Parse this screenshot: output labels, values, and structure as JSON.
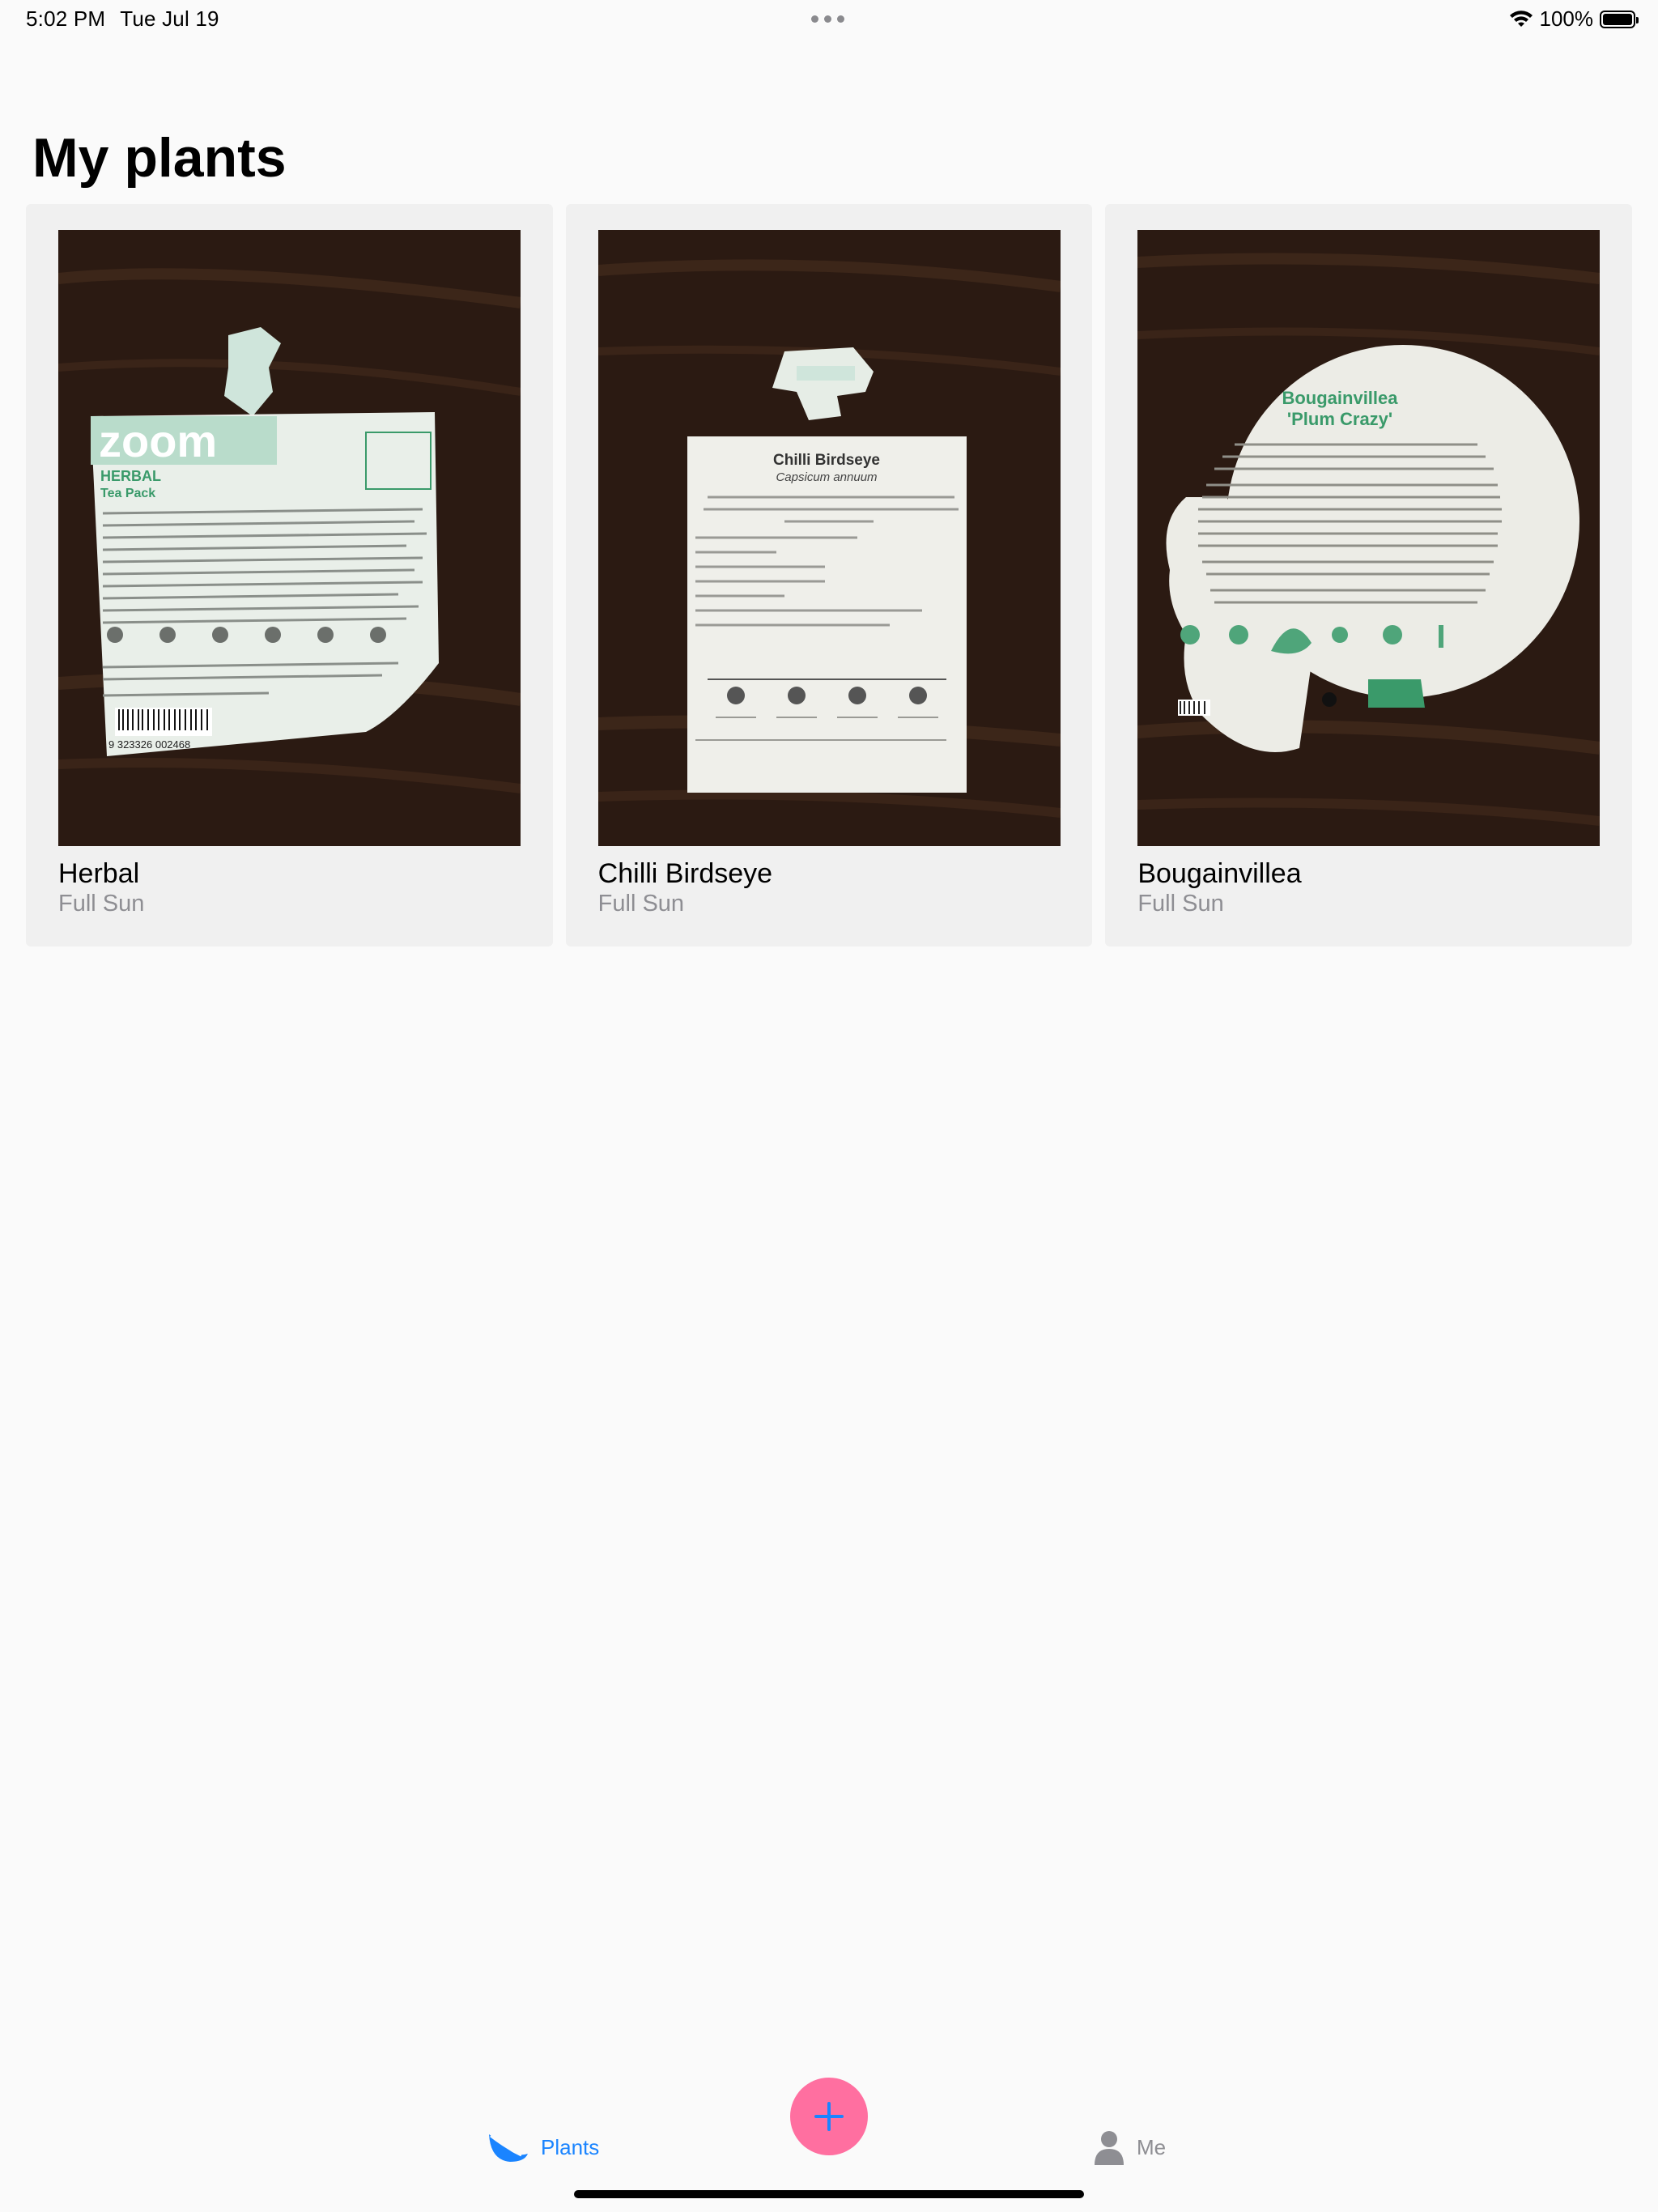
{
  "status_bar": {
    "time": "5:02 PM",
    "date": "Tue Jul 19",
    "battery": "100%"
  },
  "page": {
    "title": "My plants"
  },
  "plants": [
    {
      "name": "Herbal",
      "sun": "Full Sun",
      "photo": {
        "label_brand": "zoom",
        "label_title": "HERBAL",
        "label_subtitle": "Tea Pack",
        "barcode_number": "9 323326 002468"
      }
    },
    {
      "name": "Chilli Birdseye",
      "sun": "Full Sun",
      "photo": {
        "label_title": "Chilli Birdseye",
        "label_subtitle": "Capsicum annuum"
      }
    },
    {
      "name": "Bougainvillea",
      "sun": "Full Sun",
      "photo": {
        "label_title": "Bougainvillea",
        "label_subtitle": "'Plum Crazy'"
      }
    }
  ],
  "tab_bar": {
    "plants_label": "Plants",
    "me_label": "Me",
    "add_symbol": "+",
    "active_tab": "Plants",
    "accent_color": "#1a84ff",
    "add_button_color": "#ff6fa0"
  }
}
